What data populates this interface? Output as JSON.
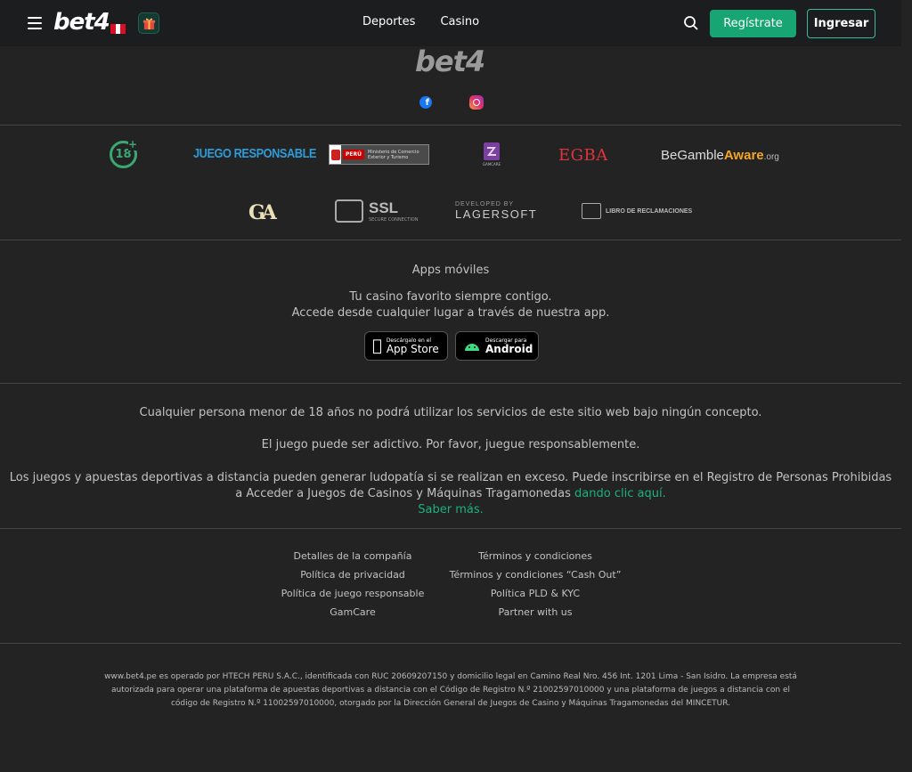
{
  "header": {
    "logo_text": "bet4",
    "nav": [
      "Deportes",
      "Casino"
    ],
    "register_label": "Regístrate",
    "login_label": "Ingresar"
  },
  "footer_logo": "bet4",
  "badges": {
    "age": "18",
    "juego_responsable": "JUEGO RESPONSABLE",
    "mincetur_country": "PERÚ",
    "mincetur_ministry": "Ministerio de Comercio Exterior y Turismo",
    "gamcare": "GAMCARE",
    "egba": "EGBA",
    "begambleaware_be": "BeGamble",
    "begambleaware_aware": "Aware",
    "begambleaware_org": ".org",
    "ga": "GA",
    "ssl": "SSL",
    "ssl_sub": "SECURE CONNECTION",
    "lagersoft_top": "DEVELOPED BY",
    "lagersoft": "LAGERSOFT",
    "libro": "LIBRO DE RECLAMACIONES"
  },
  "apps": {
    "title": "Apps móviles",
    "line1": "Tu casino favorito siempre contigo.",
    "line2": "Accede desde cualquier lugar a través de nuestra app.",
    "appstore_small": "Descárgalo en el",
    "appstore": "App Store",
    "android_small": "Descargar para",
    "android": "Android"
  },
  "legal": {
    "minor": "Cualquier persona menor de 18 años no podrá utilizar los servicios de este sitio web bajo ningún concepto.",
    "addictive": "El juego puede ser adictivo. Por favor, juegue responsablemente.",
    "ludopatia": "Los juegos y apuestas deportivas a distancia pueden generar ludopatía si se realizan en exceso. Puede inscribirse en el Registro de Personas Prohibidas a Acceder a Juegos de Casinos y Máquinas Tragamonedas",
    "click_here": "dando clic aquí.",
    "more": "Saber más."
  },
  "links_left": [
    "Detalles de la compañía",
    "Política de privacidad",
    "Política de juego responsable",
    "GamCare"
  ],
  "links_right": [
    "Términos y condiciones",
    "Términos y condiciones “Cash Out”",
    "Política PLD & KYC",
    "Partner with us"
  ],
  "fine_print": "www.bet4.pe es operado por HTECH PERU S.A.C., identificada con RUC 20609207150 y domicilio legal en Camino Real Nro. 456 Int. 1201 Lima - San Isidro. La empresa está autorizada para operar una plataforma de apuestas deportivas a distancia con el Código de Registro N.º 21002597010000 y una plataforma de juegos a distancia con el código de Registro N.º 11002597010000, otorgado por la Dirección General de Juegos de Casino y Máquinas Tragamonedas del MINCETUR.",
  "colors": {
    "accent": "#17a673",
    "background": "#232323",
    "header": "#1b1d1f"
  }
}
